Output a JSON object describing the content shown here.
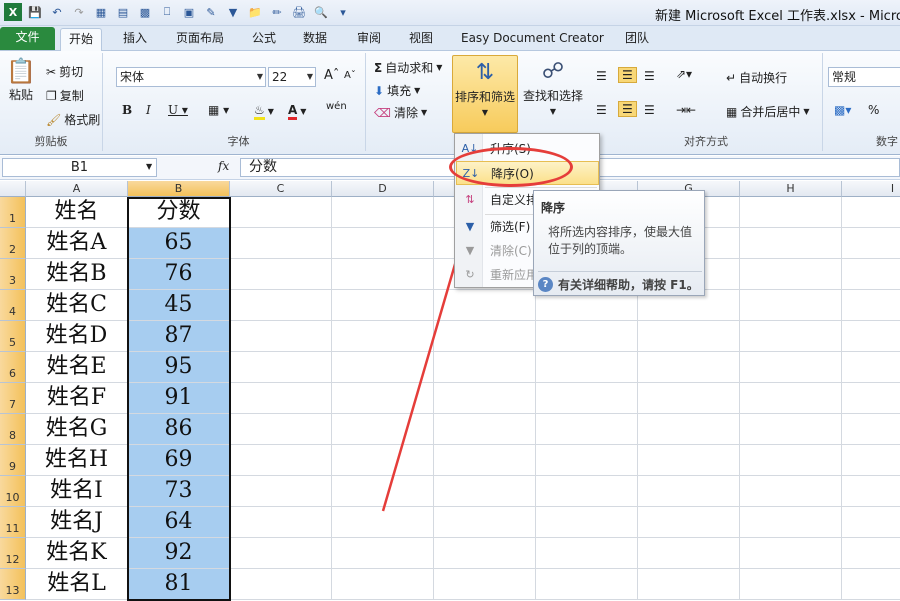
{
  "window": {
    "title": "新建 Microsoft Excel 工作表.xlsx - Microsc"
  },
  "tabs": [
    "文件",
    "开始",
    "插入",
    "页面布局",
    "公式",
    "数据",
    "审阅",
    "视图",
    "Easy Document Creator",
    "团队"
  ],
  "ribbon": {
    "clipboard": {
      "paste": "粘贴",
      "cut": "剪切",
      "copy": "复制",
      "format_painter": "格式刷",
      "label": "剪贴板"
    },
    "font": {
      "name": "宋体",
      "size": "22",
      "label": "字体"
    },
    "editing": {
      "autosum": "自动求和",
      "fill": "填充",
      "clear": "清除",
      "sort_filter": "排序和筛选",
      "find_select": "查找和选择"
    },
    "alignment": {
      "wrap": "自动换行",
      "merge": "合并后居中",
      "label": "对齐方式"
    },
    "number": {
      "format": "常规",
      "percent": "%",
      "label": "数字"
    }
  },
  "formula_bar": {
    "name_box": "B1",
    "fx": "fx",
    "value": "分数"
  },
  "columns": [
    "A",
    "B",
    "C",
    "D",
    "E",
    "F",
    "G",
    "H",
    "I"
  ],
  "rows": [
    {
      "num": "1",
      "a": "姓名",
      "b": "分数"
    },
    {
      "num": "2",
      "a": "姓名A",
      "b": "65"
    },
    {
      "num": "3",
      "a": "姓名B",
      "b": "76"
    },
    {
      "num": "4",
      "a": "姓名C",
      "b": "45"
    },
    {
      "num": "5",
      "a": "姓名D",
      "b": "87"
    },
    {
      "num": "6",
      "a": "姓名E",
      "b": "95"
    },
    {
      "num": "7",
      "a": "姓名F",
      "b": "91"
    },
    {
      "num": "8",
      "a": "姓名G",
      "b": "86"
    },
    {
      "num": "9",
      "a": "姓名H",
      "b": "69"
    },
    {
      "num": "10",
      "a": "姓名I",
      "b": "73"
    },
    {
      "num": "11",
      "a": "姓名J",
      "b": "64"
    },
    {
      "num": "12",
      "a": "姓名K",
      "b": "92"
    },
    {
      "num": "13",
      "a": "姓名L",
      "b": "81"
    }
  ],
  "sort_menu": {
    "ascending": "升序(S)",
    "descending": "降序(O)",
    "custom": "自定义排序(U)...",
    "filter": "筛选(F)",
    "clear": "清除(C)",
    "reapply": "重新应用"
  },
  "tooltip": {
    "title": "降序",
    "body": "将所选内容排序，使最大值位于列的顶端。",
    "help": "有关详细帮助，请按 F1。"
  },
  "colors": {
    "selection_fill": "#a7cdf0",
    "annotation_red": "#e53d3a",
    "file_tab_green": "#2a8a3e"
  }
}
